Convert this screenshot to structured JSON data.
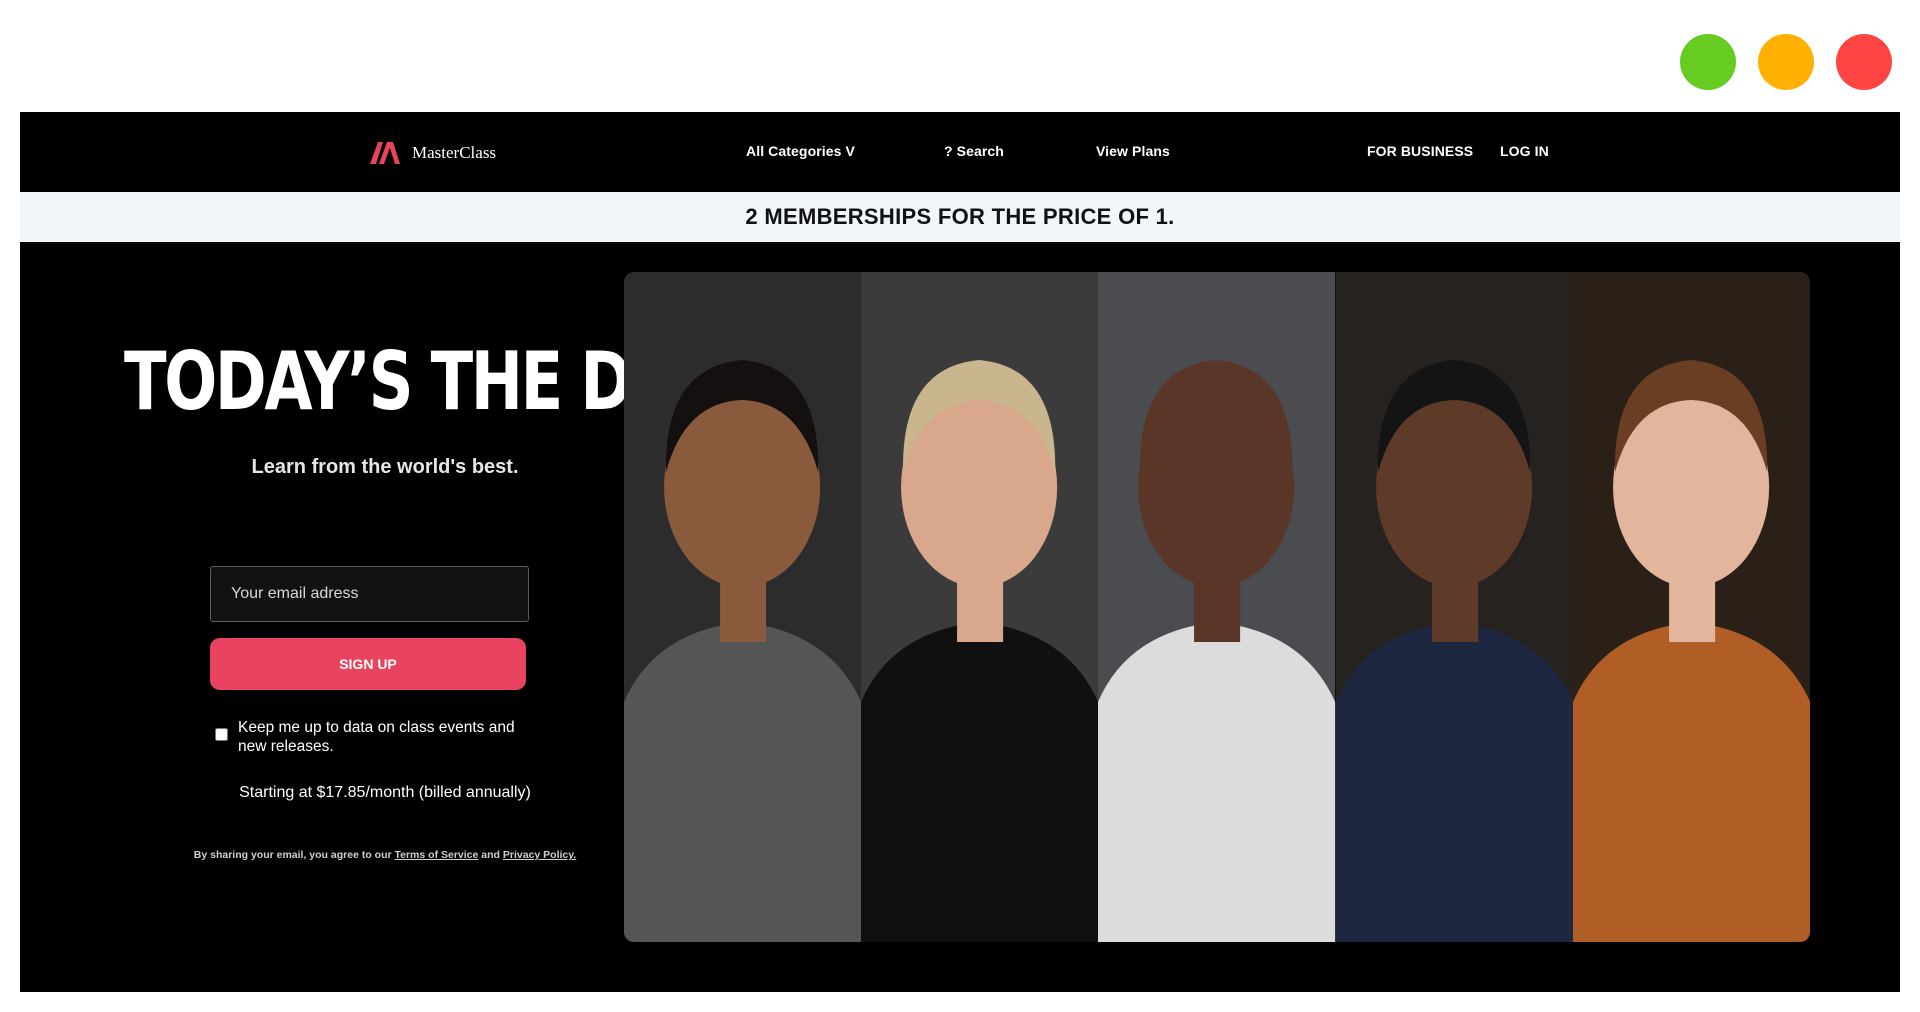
{
  "window_controls": [
    {
      "name": "green",
      "color": "#66cc22"
    },
    {
      "name": "yellow",
      "color": "#ffb000"
    },
    {
      "name": "red",
      "color": "#ff4444"
    }
  ],
  "nav": {
    "logo_text": "MasterClass",
    "categories": "All Categories V",
    "search": "? Search",
    "plans": "View Plans",
    "business": "FOR BUSINESS",
    "login": "LOG IN"
  },
  "banner": {
    "text": "2 MEMBERSHIPS FOR THE PRICE OF 1."
  },
  "hero": {
    "title": "TODAY’S THE DAY.",
    "subtitle": "Learn from the world's best.",
    "email_placeholder": "Your email adress",
    "signup_label": "SIGN UP",
    "checkbox_label": "Keep me up to data on class events and new releases.",
    "price": "Starting at $17.85/month (billed annually)",
    "legal_prefix": "By sharing your email, you agree to our",
    "terms": "Terms of Service",
    "legal_and": "and",
    "privacy": "Privacy Policy."
  },
  "colors": {
    "accent": "#e8445f",
    "banner_bg": "#f1f6fb",
    "page_bg": "#000000"
  },
  "instructors": [
    {
      "icon": "instructor-portrait-1",
      "bg": "#2c2c2c",
      "skin": "#8a5a3c",
      "hair": "#141010",
      "shirt": "#555555"
    },
    {
      "icon": "instructor-portrait-2",
      "bg": "#3a3b3a",
      "skin": "#d9a88c",
      "hair": "#c9b58e",
      "shirt": "#101010"
    },
    {
      "icon": "instructor-portrait-3",
      "bg": "#4a4c4f",
      "skin": "#5a3628",
      "hair": "#5a3628",
      "shirt": "#dcdcdc"
    },
    {
      "icon": "instructor-portrait-4",
      "bg": "#252220",
      "skin": "#5e3a28",
      "hair": "#141414",
      "shirt": "#1e2740"
    },
    {
      "icon": "instructor-portrait-5",
      "bg": "#2a2018",
      "skin": "#e2b69c",
      "hair": "#6a3e22",
      "shirt": "#b05e25"
    }
  ]
}
